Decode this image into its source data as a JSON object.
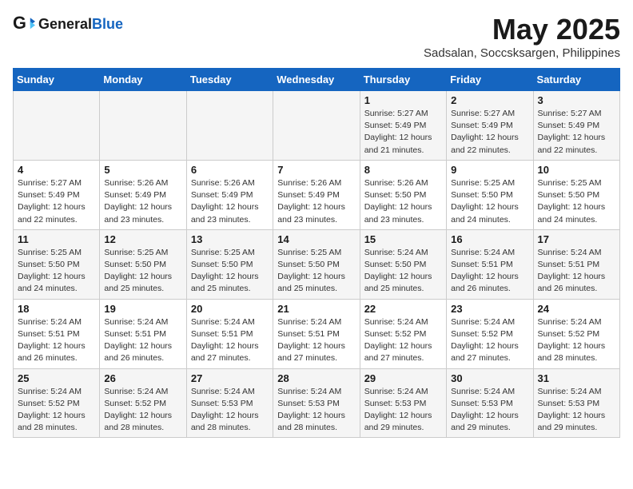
{
  "logo": {
    "general": "General",
    "blue": "Blue"
  },
  "title": "May 2025",
  "location": "Sadsalan, Soccsksargen, Philippines",
  "weekdays": [
    "Sunday",
    "Monday",
    "Tuesday",
    "Wednesday",
    "Thursday",
    "Friday",
    "Saturday"
  ],
  "weeks": [
    [
      {
        "day": "",
        "info": ""
      },
      {
        "day": "",
        "info": ""
      },
      {
        "day": "",
        "info": ""
      },
      {
        "day": "",
        "info": ""
      },
      {
        "day": "1",
        "info": "Sunrise: 5:27 AM\nSunset: 5:49 PM\nDaylight: 12 hours\nand 21 minutes."
      },
      {
        "day": "2",
        "info": "Sunrise: 5:27 AM\nSunset: 5:49 PM\nDaylight: 12 hours\nand 22 minutes."
      },
      {
        "day": "3",
        "info": "Sunrise: 5:27 AM\nSunset: 5:49 PM\nDaylight: 12 hours\nand 22 minutes."
      }
    ],
    [
      {
        "day": "4",
        "info": "Sunrise: 5:27 AM\nSunset: 5:49 PM\nDaylight: 12 hours\nand 22 minutes."
      },
      {
        "day": "5",
        "info": "Sunrise: 5:26 AM\nSunset: 5:49 PM\nDaylight: 12 hours\nand 23 minutes."
      },
      {
        "day": "6",
        "info": "Sunrise: 5:26 AM\nSunset: 5:49 PM\nDaylight: 12 hours\nand 23 minutes."
      },
      {
        "day": "7",
        "info": "Sunrise: 5:26 AM\nSunset: 5:49 PM\nDaylight: 12 hours\nand 23 minutes."
      },
      {
        "day": "8",
        "info": "Sunrise: 5:26 AM\nSunset: 5:50 PM\nDaylight: 12 hours\nand 23 minutes."
      },
      {
        "day": "9",
        "info": "Sunrise: 5:25 AM\nSunset: 5:50 PM\nDaylight: 12 hours\nand 24 minutes."
      },
      {
        "day": "10",
        "info": "Sunrise: 5:25 AM\nSunset: 5:50 PM\nDaylight: 12 hours\nand 24 minutes."
      }
    ],
    [
      {
        "day": "11",
        "info": "Sunrise: 5:25 AM\nSunset: 5:50 PM\nDaylight: 12 hours\nand 24 minutes."
      },
      {
        "day": "12",
        "info": "Sunrise: 5:25 AM\nSunset: 5:50 PM\nDaylight: 12 hours\nand 25 minutes."
      },
      {
        "day": "13",
        "info": "Sunrise: 5:25 AM\nSunset: 5:50 PM\nDaylight: 12 hours\nand 25 minutes."
      },
      {
        "day": "14",
        "info": "Sunrise: 5:25 AM\nSunset: 5:50 PM\nDaylight: 12 hours\nand 25 minutes."
      },
      {
        "day": "15",
        "info": "Sunrise: 5:24 AM\nSunset: 5:50 PM\nDaylight: 12 hours\nand 25 minutes."
      },
      {
        "day": "16",
        "info": "Sunrise: 5:24 AM\nSunset: 5:51 PM\nDaylight: 12 hours\nand 26 minutes."
      },
      {
        "day": "17",
        "info": "Sunrise: 5:24 AM\nSunset: 5:51 PM\nDaylight: 12 hours\nand 26 minutes."
      }
    ],
    [
      {
        "day": "18",
        "info": "Sunrise: 5:24 AM\nSunset: 5:51 PM\nDaylight: 12 hours\nand 26 minutes."
      },
      {
        "day": "19",
        "info": "Sunrise: 5:24 AM\nSunset: 5:51 PM\nDaylight: 12 hours\nand 26 minutes."
      },
      {
        "day": "20",
        "info": "Sunrise: 5:24 AM\nSunset: 5:51 PM\nDaylight: 12 hours\nand 27 minutes."
      },
      {
        "day": "21",
        "info": "Sunrise: 5:24 AM\nSunset: 5:51 PM\nDaylight: 12 hours\nand 27 minutes."
      },
      {
        "day": "22",
        "info": "Sunrise: 5:24 AM\nSunset: 5:52 PM\nDaylight: 12 hours\nand 27 minutes."
      },
      {
        "day": "23",
        "info": "Sunrise: 5:24 AM\nSunset: 5:52 PM\nDaylight: 12 hours\nand 27 minutes."
      },
      {
        "day": "24",
        "info": "Sunrise: 5:24 AM\nSunset: 5:52 PM\nDaylight: 12 hours\nand 28 minutes."
      }
    ],
    [
      {
        "day": "25",
        "info": "Sunrise: 5:24 AM\nSunset: 5:52 PM\nDaylight: 12 hours\nand 28 minutes."
      },
      {
        "day": "26",
        "info": "Sunrise: 5:24 AM\nSunset: 5:52 PM\nDaylight: 12 hours\nand 28 minutes."
      },
      {
        "day": "27",
        "info": "Sunrise: 5:24 AM\nSunset: 5:53 PM\nDaylight: 12 hours\nand 28 minutes."
      },
      {
        "day": "28",
        "info": "Sunrise: 5:24 AM\nSunset: 5:53 PM\nDaylight: 12 hours\nand 28 minutes."
      },
      {
        "day": "29",
        "info": "Sunrise: 5:24 AM\nSunset: 5:53 PM\nDaylight: 12 hours\nand 29 minutes."
      },
      {
        "day": "30",
        "info": "Sunrise: 5:24 AM\nSunset: 5:53 PM\nDaylight: 12 hours\nand 29 minutes."
      },
      {
        "day": "31",
        "info": "Sunrise: 5:24 AM\nSunset: 5:53 PM\nDaylight: 12 hours\nand 29 minutes."
      }
    ]
  ]
}
